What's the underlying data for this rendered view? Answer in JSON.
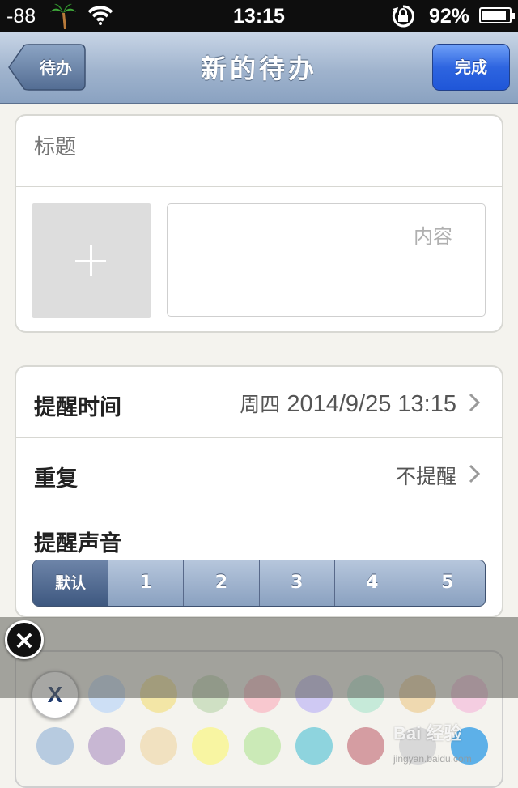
{
  "status_bar": {
    "signal": "-88",
    "time": "13:15",
    "battery_percent": "92%",
    "battery_level": 0.92
  },
  "nav": {
    "back_label": "待办",
    "title": "新的待办",
    "done_label": "完成"
  },
  "note": {
    "title_placeholder": "标题",
    "content_placeholder": "内容"
  },
  "reminder": {
    "time_label": "提醒时间",
    "time_weekday": "周四",
    "time_value": "2014/9/25 13:15",
    "repeat_label": "重复",
    "repeat_value": "不提醒",
    "sound_label": "提醒声音",
    "sound_options": [
      "默认",
      "1",
      "2",
      "3",
      "4",
      "5"
    ],
    "sound_selected": "默认"
  },
  "palette": {
    "none_label": "X",
    "colors_row1": [
      "#cddff5",
      "#f3e6a6",
      "#cfe0c4",
      "#f8c8cf",
      "#cfc9f3",
      "#c6ead9",
      "#efd9b0",
      "#f4cde1"
    ],
    "colors_row2": [
      "#b7cbe0",
      "#c8b7d3",
      "#f1e1c0",
      "#f8f5a2",
      "#cbeab7",
      "#8ed4de",
      "#d59da2",
      "#d8d8d8",
      "#5db0e8"
    ]
  },
  "watermark": {
    "brand": "Bai 经验",
    "url": "jingyan.baidu.com"
  }
}
